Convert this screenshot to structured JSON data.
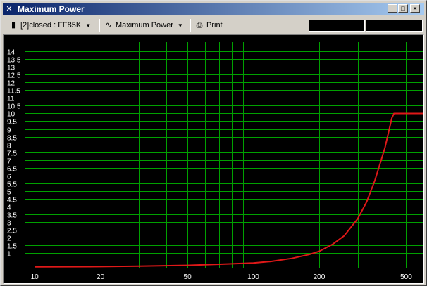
{
  "window": {
    "title": "Maximum Power",
    "controls": {
      "minimize": "_",
      "maximize": "□",
      "close": "×"
    }
  },
  "toolbar": {
    "driver_select": {
      "value": "[2]closed : FF85K",
      "icon": "speaker-icon"
    },
    "graph_select": {
      "value": "Maximum Power",
      "icon": "sine-wave-icon"
    },
    "print_label": "Print",
    "print_icon": "printer-icon"
  },
  "colors": {
    "background": "#000000",
    "grid": "#00a000",
    "curve": "#e01818",
    "labels": "#ffffff"
  },
  "chart_data": {
    "type": "line",
    "title": "",
    "xlabel": "",
    "ylabel": "",
    "x_scale": "log",
    "xlim": [
      9,
      600
    ],
    "ylim": [
      0,
      14.6
    ],
    "grid": true,
    "x_ticks": [
      10,
      20,
      50,
      100,
      200,
      500
    ],
    "y_ticks": [
      1,
      1.5,
      2,
      2.5,
      3,
      3.5,
      4,
      4.5,
      5,
      5.5,
      6,
      6.5,
      7,
      7.5,
      8,
      8.5,
      9,
      9.5,
      10,
      10.5,
      11,
      11.5,
      12,
      12.5,
      13,
      13.5,
      14
    ],
    "series": [
      {
        "x": [
          10,
          20,
          30,
          50,
          80,
          100,
          120,
          150,
          180,
          200,
          230,
          260,
          300,
          330,
          360,
          400,
          430,
          440,
          500,
          600
        ],
        "values": [
          0.1,
          0.12,
          0.15,
          0.2,
          0.3,
          0.35,
          0.45,
          0.65,
          0.9,
          1.1,
          1.55,
          2.1,
          3.2,
          4.3,
          5.7,
          7.8,
          9.7,
          10.0,
          10.0,
          10.0
        ]
      }
    ]
  }
}
